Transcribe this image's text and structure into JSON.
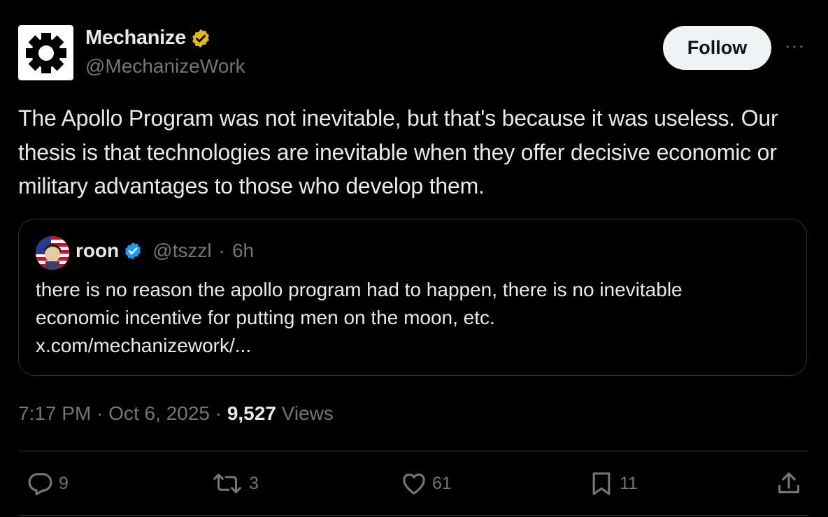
{
  "author": {
    "display_name": "Mechanize",
    "handle": "@MechanizeWork",
    "verified_badge": "gold-verified-icon",
    "avatar_icon": "gear-icon"
  },
  "header": {
    "follow_label": "Follow",
    "more_icon": "more-icon",
    "more_glyph": "···"
  },
  "tweet": {
    "text": "The Apollo Program was not inevitable, but that's because it was useless. Our thesis is that technologies are inevitable when they offer decisive economic or military advantages to those who develop them."
  },
  "quoted": {
    "display_name": "roon",
    "handle": "@tszzl",
    "separator": "·",
    "age": "6h",
    "text_line1": "there is no reason the apollo program had to happen, there is no inevitable",
    "text_line2": "economic incentive for putting men on the moon, etc.",
    "link": "x.com/mechanizework/..."
  },
  "meta": {
    "time": "7:17 PM",
    "sep1": " · ",
    "date": "Oct 6, 2025",
    "sep2": " · ",
    "views_count": "9,527",
    "views_label": " Views"
  },
  "actions": {
    "replies": "9",
    "reposts": "3",
    "likes": "61",
    "bookmarks": "11"
  },
  "colors": {
    "background": "#000000",
    "text": "#e7e9ea",
    "secondary": "#71767b",
    "border": "#2f3336",
    "gold_badge": "#e2b719",
    "blue_badge": "#1d9bf0"
  }
}
